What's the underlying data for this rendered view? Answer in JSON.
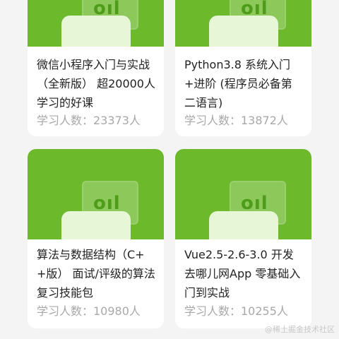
{
  "courses": [
    {
      "title": "微信小程序入门与实战（全新版） 超20000人学习的好课",
      "students": "学习人数：23373人",
      "thumb_glyph": "oıl"
    },
    {
      "title": "Python3.8 系统入门+进阶 (程序员必备第二语言)",
      "students": "学习人数：13872人",
      "thumb_glyph": "oıl"
    },
    {
      "title": "算法与数据结构（C++版） 面试/评级的算法复习技能包",
      "students": "学习人数：10980人",
      "thumb_glyph": "oıl"
    },
    {
      "title": "Vue2.5-2.6-3.0 开发去哪儿网App 零基础入门到实战",
      "students": "学习人数：10255人",
      "thumb_glyph": "oıl"
    }
  ],
  "watermark": "@稀土掘金技术社区",
  "colors": {
    "thumb_green": "#6cb92c",
    "card_bg": "#ffffff",
    "page_bg": "#f4f4f4"
  }
}
